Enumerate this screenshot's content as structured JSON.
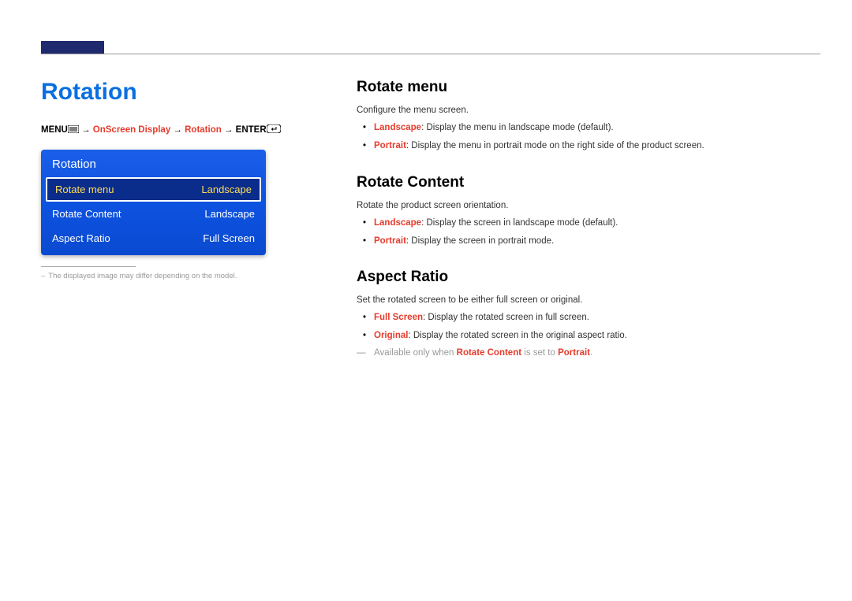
{
  "pageTitle": "Rotation",
  "navPath": {
    "menu": "MENU",
    "p1": "OnScreen Display",
    "p2": "Rotation",
    "enter": "ENTER",
    "arrow": " → "
  },
  "osd": {
    "header": "Rotation",
    "rows": [
      {
        "label": "Rotate menu",
        "value": "Landscape",
        "selected": true
      },
      {
        "label": "Rotate Content",
        "value": "Landscape",
        "selected": false
      },
      {
        "label": "Aspect Ratio",
        "value": "Full Screen",
        "selected": false
      }
    ]
  },
  "footnote": "The displayed image may differ depending on the model.",
  "sections": {
    "rotateMenu": {
      "title": "Rotate menu",
      "desc": "Configure the menu screen.",
      "items": [
        {
          "term": "Landscape",
          "rest": ": Display the menu in landscape mode (default)."
        },
        {
          "term": "Portrait",
          "rest": ": Display the menu in portrait mode on the right side of the product screen."
        }
      ]
    },
    "rotateContent": {
      "title": "Rotate Content",
      "desc": "Rotate the product screen orientation.",
      "items": [
        {
          "term": "Landscape",
          "rest": ": Display the screen in landscape mode (default)."
        },
        {
          "term": "Portrait",
          "rest": ": Display the screen in portrait mode."
        }
      ]
    },
    "aspectRatio": {
      "title": "Aspect Ratio",
      "desc": "Set the rotated screen to be either full screen or original.",
      "items": [
        {
          "term": "Full Screen",
          "rest": ": Display the rotated screen in full screen."
        },
        {
          "term": "Original",
          "rest": ": Display the rotated screen in the original aspect ratio."
        }
      ],
      "note": {
        "pre": "Available only when ",
        "b1": "Rotate Content",
        "mid": " is set to ",
        "b2": "Portrait",
        "post": "."
      }
    }
  }
}
